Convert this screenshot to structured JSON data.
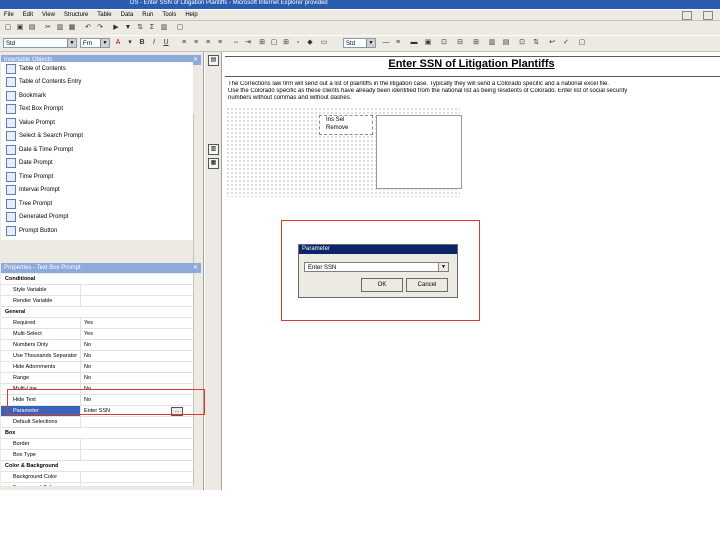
{
  "window": {
    "title": "DS - Enter SSN of Litigation Plantiffs - Microsoft Internet Explorer provided"
  },
  "menu": {
    "items": [
      "File",
      "Edit",
      "View",
      "Structure",
      "Table",
      "Data",
      "Run",
      "Tools",
      "Help"
    ]
  },
  "toolbar": {
    "font_style": "Std",
    "font_family": "Frn",
    "font_size": "Std"
  },
  "insertable_objects": {
    "header": "Insertable Objects",
    "items": [
      "Table of Contents",
      "Table of Contents Entry",
      "Bookmark",
      "Text Box Prompt",
      "Value Prompt",
      "Select & Search Prompt",
      "Date & Time Prompt",
      "Date Prompt",
      "Time Prompt",
      "Interval Prompt",
      "Tree Prompt",
      "Generated Prompt",
      "Prompt Button"
    ]
  },
  "properties": {
    "header": "Properties - Text Box Prompt",
    "rows": [
      {
        "name": "Conditional",
        "value": "",
        "section": true
      },
      {
        "name": "Style Variable",
        "value": ""
      },
      {
        "name": "Render Variable",
        "value": ""
      },
      {
        "name": "General",
        "value": "",
        "section": true
      },
      {
        "name": "Required",
        "value": "Yes"
      },
      {
        "name": "Multi-Select",
        "value": "Yes"
      },
      {
        "name": "Numbers Only",
        "value": "No"
      },
      {
        "name": "Use Thousands Separator",
        "value": "No"
      },
      {
        "name": "Hide Adornments",
        "value": "No"
      },
      {
        "name": "Range",
        "value": "No"
      },
      {
        "name": "Multi-Line",
        "value": "No"
      },
      {
        "name": "Hide Text",
        "value": "No"
      },
      {
        "name": "Parameter",
        "value": "Enter SSN",
        "selected": true
      },
      {
        "name": "Default Selections",
        "value": ""
      },
      {
        "name": "Box",
        "value": "",
        "section": true
      },
      {
        "name": "Border",
        "value": ""
      },
      {
        "name": "Box Type",
        "value": ""
      },
      {
        "name": "Color & Background",
        "value": "",
        "section": true
      },
      {
        "name": "Background Color",
        "value": ""
      },
      {
        "name": "Foreground Color",
        "value": ""
      },
      {
        "name": "Font & Text",
        "value": "",
        "section": true
      }
    ]
  },
  "document": {
    "title": "Enter SSN of Litigation Plantiffs",
    "description_lines": [
      "The Corrections law firm will send out a list of plaintiffs in the litigation case. Typically they will send a Colorado specific and a national excel file.",
      "Use the Colorado specific as these clients have already been identified from the national list as being residents of Colorado. Enter list of social security",
      "numbers without commas and without dashes."
    ],
    "control_line1": "Ins Sel",
    "control_line2": "Remove"
  },
  "dialog": {
    "title": "Parameter",
    "selected": "Enter SSN",
    "ok": "OK",
    "cancel": "Cancel"
  },
  "colors": {
    "highlight_red": "#e0382f",
    "title_bar": "#2a5db0",
    "selection": "#3a63b5"
  }
}
